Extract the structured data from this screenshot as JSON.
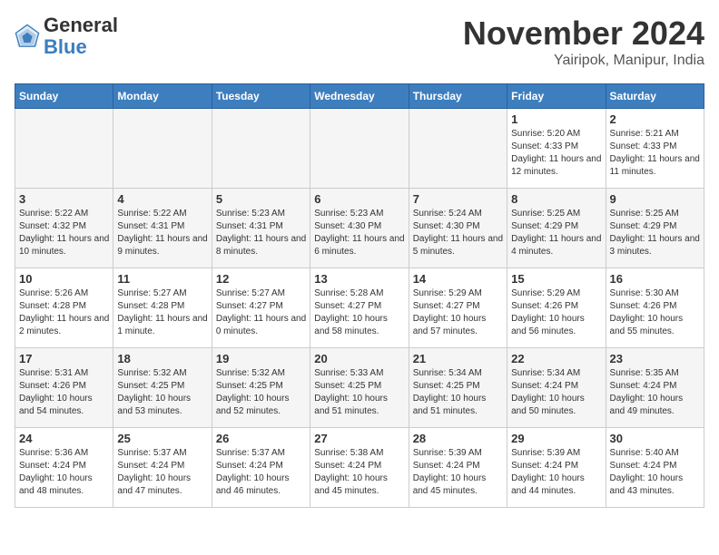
{
  "header": {
    "logo": {
      "general": "General",
      "blue": "Blue"
    },
    "month_title": "November 2024",
    "location": "Yairipok, Manipur, India"
  },
  "days_of_week": [
    "Sunday",
    "Monday",
    "Tuesday",
    "Wednesday",
    "Thursday",
    "Friday",
    "Saturday"
  ],
  "weeks": [
    [
      {
        "day": "",
        "empty": true
      },
      {
        "day": "",
        "empty": true
      },
      {
        "day": "",
        "empty": true
      },
      {
        "day": "",
        "empty": true
      },
      {
        "day": "",
        "empty": true
      },
      {
        "day": "1",
        "sunrise": "5:20 AM",
        "sunset": "4:33 PM",
        "daylight": "11 hours and 12 minutes."
      },
      {
        "day": "2",
        "sunrise": "5:21 AM",
        "sunset": "4:33 PM",
        "daylight": "11 hours and 11 minutes."
      }
    ],
    [
      {
        "day": "3",
        "sunrise": "5:22 AM",
        "sunset": "4:32 PM",
        "daylight": "11 hours and 10 minutes."
      },
      {
        "day": "4",
        "sunrise": "5:22 AM",
        "sunset": "4:31 PM",
        "daylight": "11 hours and 9 minutes."
      },
      {
        "day": "5",
        "sunrise": "5:23 AM",
        "sunset": "4:31 PM",
        "daylight": "11 hours and 8 minutes."
      },
      {
        "day": "6",
        "sunrise": "5:23 AM",
        "sunset": "4:30 PM",
        "daylight": "11 hours and 6 minutes."
      },
      {
        "day": "7",
        "sunrise": "5:24 AM",
        "sunset": "4:30 PM",
        "daylight": "11 hours and 5 minutes."
      },
      {
        "day": "8",
        "sunrise": "5:25 AM",
        "sunset": "4:29 PM",
        "daylight": "11 hours and 4 minutes."
      },
      {
        "day": "9",
        "sunrise": "5:25 AM",
        "sunset": "4:29 PM",
        "daylight": "11 hours and 3 minutes."
      }
    ],
    [
      {
        "day": "10",
        "sunrise": "5:26 AM",
        "sunset": "4:28 PM",
        "daylight": "11 hours and 2 minutes."
      },
      {
        "day": "11",
        "sunrise": "5:27 AM",
        "sunset": "4:28 PM",
        "daylight": "11 hours and 1 minute."
      },
      {
        "day": "12",
        "sunrise": "5:27 AM",
        "sunset": "4:27 PM",
        "daylight": "11 hours and 0 minutes."
      },
      {
        "day": "13",
        "sunrise": "5:28 AM",
        "sunset": "4:27 PM",
        "daylight": "10 hours and 58 minutes."
      },
      {
        "day": "14",
        "sunrise": "5:29 AM",
        "sunset": "4:27 PM",
        "daylight": "10 hours and 57 minutes."
      },
      {
        "day": "15",
        "sunrise": "5:29 AM",
        "sunset": "4:26 PM",
        "daylight": "10 hours and 56 minutes."
      },
      {
        "day": "16",
        "sunrise": "5:30 AM",
        "sunset": "4:26 PM",
        "daylight": "10 hours and 55 minutes."
      }
    ],
    [
      {
        "day": "17",
        "sunrise": "5:31 AM",
        "sunset": "4:26 PM",
        "daylight": "10 hours and 54 minutes."
      },
      {
        "day": "18",
        "sunrise": "5:32 AM",
        "sunset": "4:25 PM",
        "daylight": "10 hours and 53 minutes."
      },
      {
        "day": "19",
        "sunrise": "5:32 AM",
        "sunset": "4:25 PM",
        "daylight": "10 hours and 52 minutes."
      },
      {
        "day": "20",
        "sunrise": "5:33 AM",
        "sunset": "4:25 PM",
        "daylight": "10 hours and 51 minutes."
      },
      {
        "day": "21",
        "sunrise": "5:34 AM",
        "sunset": "4:25 PM",
        "daylight": "10 hours and 51 minutes."
      },
      {
        "day": "22",
        "sunrise": "5:34 AM",
        "sunset": "4:24 PM",
        "daylight": "10 hours and 50 minutes."
      },
      {
        "day": "23",
        "sunrise": "5:35 AM",
        "sunset": "4:24 PM",
        "daylight": "10 hours and 49 minutes."
      }
    ],
    [
      {
        "day": "24",
        "sunrise": "5:36 AM",
        "sunset": "4:24 PM",
        "daylight": "10 hours and 48 minutes."
      },
      {
        "day": "25",
        "sunrise": "5:37 AM",
        "sunset": "4:24 PM",
        "daylight": "10 hours and 47 minutes."
      },
      {
        "day": "26",
        "sunrise": "5:37 AM",
        "sunset": "4:24 PM",
        "daylight": "10 hours and 46 minutes."
      },
      {
        "day": "27",
        "sunrise": "5:38 AM",
        "sunset": "4:24 PM",
        "daylight": "10 hours and 45 minutes."
      },
      {
        "day": "28",
        "sunrise": "5:39 AM",
        "sunset": "4:24 PM",
        "daylight": "10 hours and 45 minutes."
      },
      {
        "day": "29",
        "sunrise": "5:39 AM",
        "sunset": "4:24 PM",
        "daylight": "10 hours and 44 minutes."
      },
      {
        "day": "30",
        "sunrise": "5:40 AM",
        "sunset": "4:24 PM",
        "daylight": "10 hours and 43 minutes."
      }
    ]
  ]
}
